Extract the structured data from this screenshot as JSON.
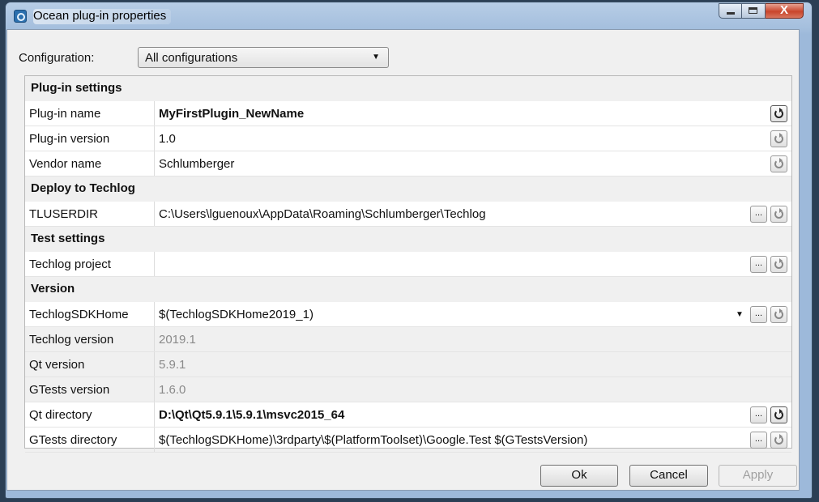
{
  "window": {
    "title": "Ocean plug-in properties",
    "close_glyph": "X"
  },
  "config": {
    "label": "Configuration:",
    "selected": "All configurations"
  },
  "sections": {
    "plugin_settings": "Plug-in settings",
    "deploy": "Deploy to Techlog",
    "test": "Test settings",
    "version": "Version"
  },
  "props": {
    "plugin_name": {
      "name": "Plug-in name",
      "value": "MyFirstPlugin_NewName"
    },
    "plugin_version": {
      "name": "Plug-in version",
      "value": "1.0"
    },
    "vendor_name": {
      "name": "Vendor name",
      "value": "Schlumberger"
    },
    "tluserdir": {
      "name": "TLUSERDIR",
      "value": "C:\\Users\\lguenoux\\AppData\\Roaming\\Schlumberger\\Techlog"
    },
    "techlog_project": {
      "name": "Techlog project",
      "value": ""
    },
    "sdk_home": {
      "name": "TechlogSDKHome",
      "value": "$(TechlogSDKHome2019_1)"
    },
    "techlog_version": {
      "name": "Techlog version",
      "value": "2019.1"
    },
    "qt_version": {
      "name": "Qt version",
      "value": "5.9.1"
    },
    "gtests_version": {
      "name": "GTests version",
      "value": "1.6.0"
    },
    "qt_directory": {
      "name": "Qt directory",
      "value": "D:\\Qt\\Qt5.9.1\\5.9.1\\msvc2015_64"
    },
    "gtests_directory": {
      "name": "GTests directory",
      "value": "$(TechlogSDKHome)\\3rdparty\\$(PlatformToolset)\\Google.Test $(GTestsVersion)"
    }
  },
  "browse_label": "...",
  "buttons": {
    "ok": "Ok",
    "cancel": "Cancel",
    "apply": "Apply"
  },
  "icons": {
    "app": "ocean-app-icon",
    "reset": "reset-icon",
    "dropdown": "chevron-down-icon"
  },
  "colors": {
    "title_bar": "#a6c0de",
    "close_button": "#c9452b",
    "category_bg": "#f0f0f0"
  }
}
